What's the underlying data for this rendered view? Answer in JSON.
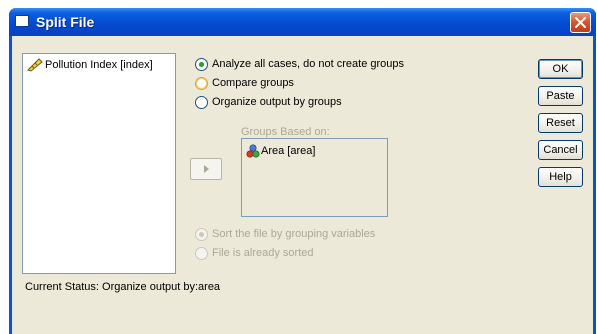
{
  "window": {
    "title": "Split File"
  },
  "variables": [
    {
      "label": "Pollution Index [index]",
      "icon": "ruler-scale-icon"
    }
  ],
  "options": {
    "analyze_all": "Analyze all cases, do not create groups",
    "compare_groups": "Compare groups",
    "organize_output": "Organize output by groups",
    "selected": "analyze_all"
  },
  "groups": {
    "label": "Groups Based on:",
    "items": [
      {
        "label": "Area [area]",
        "icon": "nominal-variable-icon"
      }
    ]
  },
  "sort": {
    "sort_by_grouping": "Sort the file by grouping variables",
    "already_sorted": "File is already sorted",
    "selected": "sort_by_grouping"
  },
  "buttons": {
    "ok": "OK",
    "paste": "Paste",
    "reset": "Reset",
    "cancel": "Cancel",
    "help": "Help"
  },
  "status": "Current Status:  Organize output by:area"
}
